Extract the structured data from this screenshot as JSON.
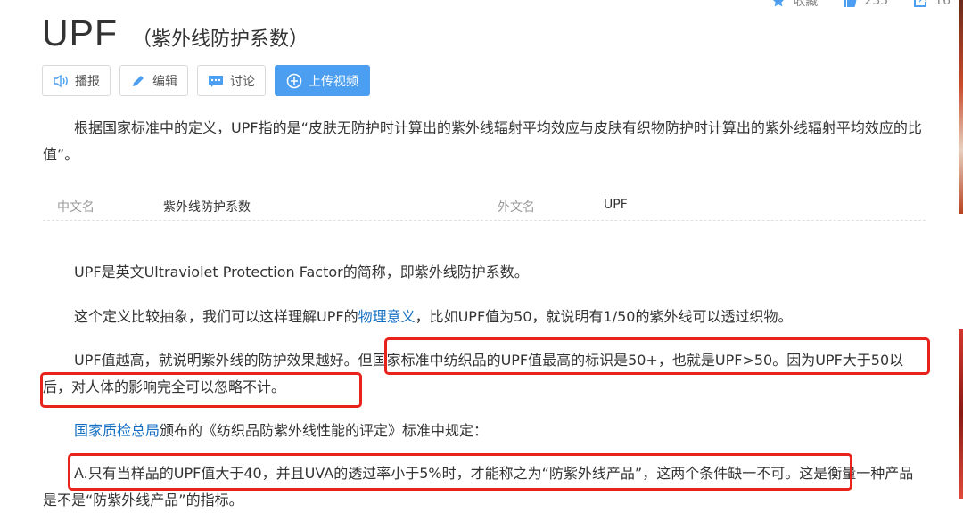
{
  "stats": {
    "favorite_label": "收藏",
    "like_count": "235",
    "share_count": "16"
  },
  "title": {
    "main": "UPF",
    "sub": "（紫外线防护系数）"
  },
  "toolbar": {
    "broadcast_label": "播报",
    "edit_label": "编辑",
    "discuss_label": "讨论",
    "upload_label": "上传视频"
  },
  "summary": "根据国家标准中的定义，UPF指的是“皮肤无防护时计算出的紫外线辐射平均效应与皮肤有织物防护时计算出的紫外线辐射平均效应的比值”。",
  "basic_info": {
    "cn_name_label": "中文名",
    "cn_name_value": "紫外线防护系数",
    "en_name_label": "外文名",
    "en_name_value": "UPF"
  },
  "paragraphs": {
    "p1": "UPF是英文Ultraviolet Protection Factor的简称，即紫外线防护系数。",
    "p2_before": "这个定义比较抽象，我们可以这样理解UPF的",
    "p2_link": "物理意义",
    "p2_after": "，比如UPF值为50，就说明有1/50的紫外线可以透过织物。",
    "p3": "UPF值越高，就说明紫外线的防护效果越好。但国家标准中纺织品的UPF值最高的标识是50+，也就是UPF>50。因为UPF大于50以后，对人体的影响完全可以忽略不计。",
    "p4_link": "国家质检总局",
    "p4_after": "颁布的《纺织品防紫外线性能的评定》标准中规定：",
    "p5": "A.只有当样品的UPF值大于40，并且UVA的透过率小于5%时，才能称之为“防紫外线产品”，这两个条件缺一不可。这是衡量一种产品是不是“防紫外线产品”的指标。"
  },
  "colors": {
    "highlight_box": "#e8231c",
    "link": "#136ec2",
    "primary_button": "#4c9ff0"
  }
}
